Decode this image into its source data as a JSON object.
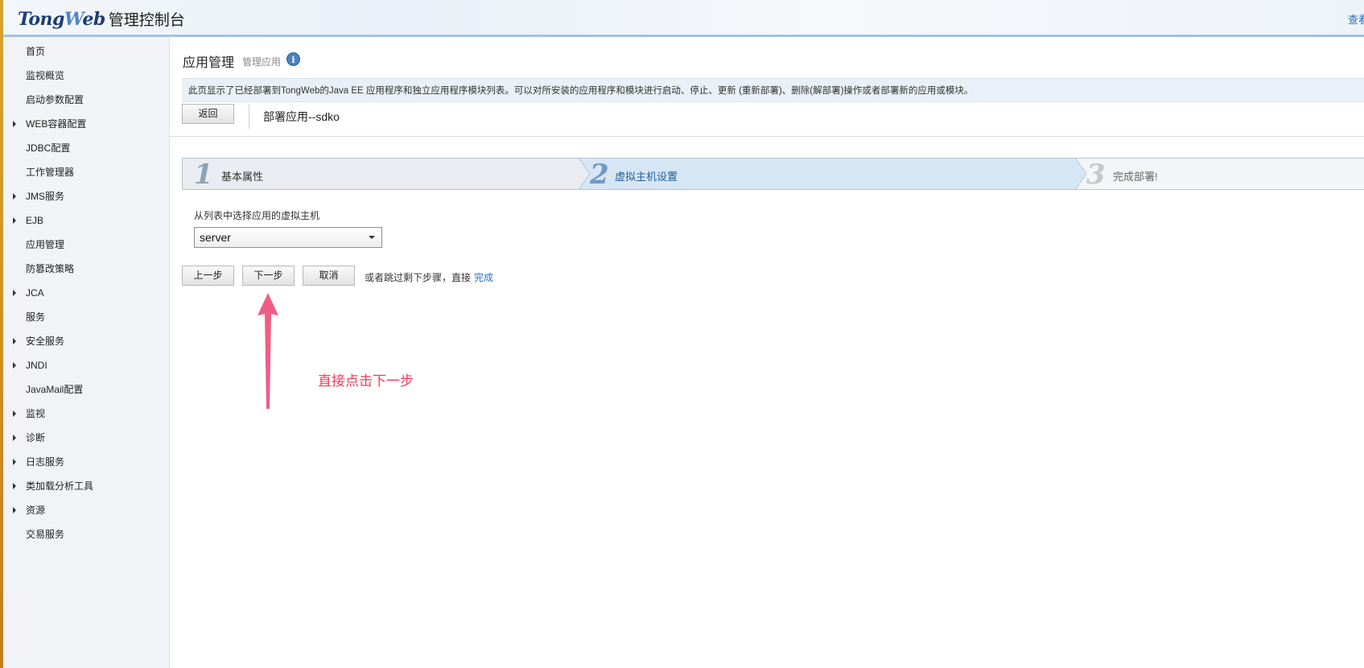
{
  "header": {
    "logo_brand_a": "Tong",
    "logo_brand_w": "W",
    "logo_brand_b": "eb",
    "logo_suffix": "管理控制台",
    "right_link": "查看"
  },
  "sidebar": {
    "items": [
      {
        "label": "首页",
        "expandable": false
      },
      {
        "label": "监视概览",
        "expandable": false
      },
      {
        "label": "启动参数配置",
        "expandable": false
      },
      {
        "label": "WEB容器配置",
        "expandable": true
      },
      {
        "label": "JDBC配置",
        "expandable": false
      },
      {
        "label": "工作管理器",
        "expandable": false
      },
      {
        "label": "JMS服务",
        "expandable": true
      },
      {
        "label": "EJB",
        "expandable": true
      },
      {
        "label": "应用管理",
        "expandable": false
      },
      {
        "label": "防篡改策略",
        "expandable": false
      },
      {
        "label": "JCA",
        "expandable": true
      },
      {
        "label": "服务",
        "expandable": false
      },
      {
        "label": "安全服务",
        "expandable": true
      },
      {
        "label": "JNDI",
        "expandable": true
      },
      {
        "label": "JavaMail配置",
        "expandable": false
      },
      {
        "label": "监视",
        "expandable": true
      },
      {
        "label": "诊断",
        "expandable": true
      },
      {
        "label": "日志服务",
        "expandable": true
      },
      {
        "label": "类加载分析工具",
        "expandable": true
      },
      {
        "label": "资源",
        "expandable": true
      },
      {
        "label": "交易服务",
        "expandable": false
      }
    ]
  },
  "main": {
    "title": "应用管理",
    "subtitle": "管理应用",
    "info_icon_glyph": "i",
    "info_text": "此页显示了已经部署到TongWeb的Java EE 应用程序和独立应用程序模块列表。可以对所安装的应用程序和模块进行启动、停止、更新 (重新部署)、删除(解部署)操作或者部署新的应用或模块。",
    "back_label": "返回",
    "deploy_title": "部署应用--sdko",
    "steps": [
      {
        "num": "1",
        "label": "基本属性"
      },
      {
        "num": "2",
        "label": "虚拟主机设置"
      },
      {
        "num": "3",
        "label": "完成部署!"
      }
    ],
    "select_label": "从列表中选择应用的虚拟主机",
    "select_value": "server",
    "prev_label": "上一步",
    "next_label": "下一步",
    "cancel_label": "取消",
    "hint_text": "或者跳过剩下步骤，直接",
    "finish_link": "完成",
    "annotation": "直接点击下一步"
  },
  "colors": {
    "annotation": "#ef3c59",
    "link": "#2a6fb8",
    "active_step": "#d7e6f5"
  }
}
